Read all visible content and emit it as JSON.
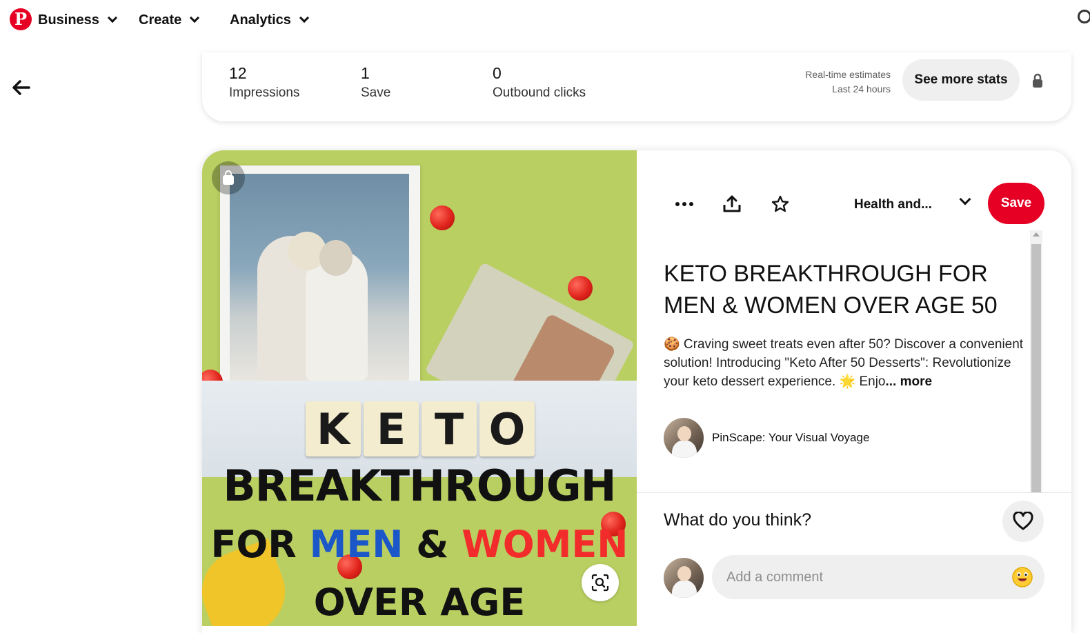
{
  "nav": {
    "items": [
      {
        "label": "Business"
      },
      {
        "label": "Create"
      },
      {
        "label": "Analytics"
      }
    ]
  },
  "stats": {
    "items": [
      {
        "value": "12",
        "label": "Impressions"
      },
      {
        "value": "1",
        "label": "Save"
      },
      {
        "value": "0",
        "label": "Outbound clicks"
      }
    ],
    "realtime_line1": "Real-time estimates",
    "realtime_line2": "Last 24 hours",
    "see_more_label": "See more stats"
  },
  "pin_image": {
    "tiles": [
      "K",
      "E",
      "T",
      "O"
    ],
    "line1": "BREAKTHROUGH",
    "line2_part1": "FOR ",
    "line2_part2": "MEN",
    "line2_part3": " & ",
    "line2_part4": "WOMEN",
    "line3": "OVER AGE"
  },
  "actions": {
    "board_name": "Health and...",
    "save_label": "Save"
  },
  "pin": {
    "title": "KETO BREAKTHROUGH FOR MEN & WOMEN OVER AGE 50",
    "description": "🍪 Craving sweet treats even after 50? Discover a convenient solution! Introducing \"Keto After 50 Desserts\": Revolutionize your keto dessert experience. 🌟 Enjo",
    "more_label": "... more",
    "author": "PinScape: Your Visual Voyage"
  },
  "comments": {
    "heading": "What do you think?",
    "placeholder": "Add a comment"
  },
  "colors": {
    "brand": "#e60023",
    "blue_text": "#1b57c8",
    "red_text": "#f22b2b"
  }
}
